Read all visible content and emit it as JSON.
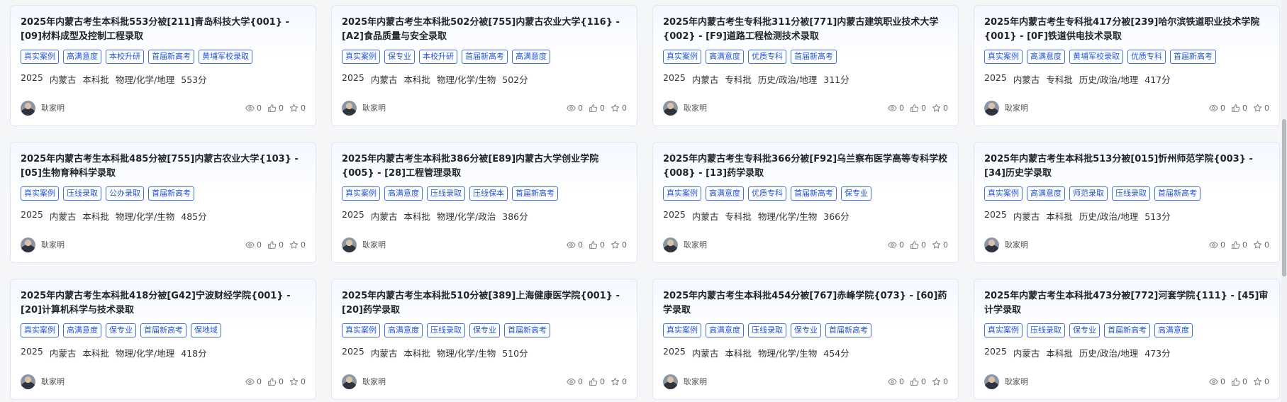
{
  "cards": [
    {
      "title": "2025年内蒙古考生本科批553分被[211]青岛科技大学{001} - [09]材料成型及控制工程录取",
      "tags": [
        "真实案例",
        "高满意度",
        "本校升研",
        "首届新高考",
        "黄埔军校录取"
      ],
      "meta": [
        "2025",
        "内蒙古",
        "本科批",
        "物理/化学/地理",
        "553分"
      ],
      "author": "耿家明",
      "views": "0",
      "likes": "0",
      "stars": "0"
    },
    {
      "title": "2025年内蒙古考生本科批502分被[755]内蒙古农业大学{116} - [A2]食品质量与安全录取",
      "tags": [
        "真实案例",
        "保专业",
        "本校升研",
        "首届新高考",
        "高满意度"
      ],
      "meta": [
        "2025",
        "内蒙古",
        "本科批",
        "物理/化学/生物",
        "502分"
      ],
      "author": "耿家明",
      "views": "0",
      "likes": "0",
      "stars": "0"
    },
    {
      "title": "2025年内蒙古考生专科批311分被[771]内蒙古建筑职业技术大学{002} - [F9]道路工程检测技术录取",
      "tags": [
        "真实案例",
        "高满意度",
        "优质专科",
        "首届新高考"
      ],
      "meta": [
        "2025",
        "内蒙古",
        "专科批",
        "历史/政治/地理",
        "311分"
      ],
      "author": "耿家明",
      "views": "0",
      "likes": "0",
      "stars": "0"
    },
    {
      "title": "2025年内蒙古考生专科批417分被[239]哈尔滨铁道职业技术学院{001} - [0F]铁道供电技术录取",
      "tags": [
        "真实案例",
        "高满意度",
        "黄埔军校录取",
        "优质专科",
        "首届新高考"
      ],
      "meta": [
        "2025",
        "内蒙古",
        "专科批",
        "历史/政治/地理",
        "417分"
      ],
      "author": "耿家明",
      "views": "0",
      "likes": "0",
      "stars": "0"
    },
    {
      "title": "2025年内蒙古考生本科批485分被[755]内蒙古农业大学{103} - [05]生物育种科学录取",
      "tags": [
        "真实案例",
        "压线录取",
        "公办录取",
        "首届新高考"
      ],
      "meta": [
        "2025",
        "内蒙古",
        "本科批",
        "物理/化学/生物",
        "485分"
      ],
      "author": "耿家明",
      "views": "0",
      "likes": "0",
      "stars": "0"
    },
    {
      "title": "2025年内蒙古考生本科批386分被[E89]内蒙古大学创业学院{005} - [28]工程管理录取",
      "tags": [
        "真实案例",
        "高满意度",
        "压线录取",
        "压线保本",
        "首届新高考"
      ],
      "meta": [
        "2025",
        "内蒙古",
        "本科批",
        "物理/化学/政治",
        "386分"
      ],
      "author": "耿家明",
      "views": "0",
      "likes": "0",
      "stars": "0"
    },
    {
      "title": "2025年内蒙古考生专科批366分被[F92]乌兰察布医学高等专科学校{008} - [13]药学录取",
      "tags": [
        "真实案例",
        "高满意度",
        "优质专科",
        "首届新高考",
        "保专业"
      ],
      "meta": [
        "2025",
        "内蒙古",
        "专科批",
        "物理/化学/生物",
        "366分"
      ],
      "author": "耿家明",
      "views": "0",
      "likes": "0",
      "stars": "0"
    },
    {
      "title": "2025年内蒙古考生本科批513分被[015]忻州师范学院{003} - [34]历史学录取",
      "tags": [
        "真实案例",
        "高满意度",
        "师范录取",
        "压线录取",
        "首届新高考"
      ],
      "meta": [
        "2025",
        "内蒙古",
        "本科批",
        "历史/政治/地理",
        "513分"
      ],
      "author": "耿家明",
      "views": "0",
      "likes": "0",
      "stars": "0"
    },
    {
      "title": "2025年内蒙古考生本科批418分被[G42]宁波财经学院{001} - [20]计算机科学与技术录取",
      "tags": [
        "真实案例",
        "高满意度",
        "保专业",
        "首届新高考",
        "保地域"
      ],
      "meta": [
        "2025",
        "内蒙古",
        "本科批",
        "物理/化学/地理",
        "418分"
      ],
      "author": "耿家明",
      "views": "0",
      "likes": "0",
      "stars": "0"
    },
    {
      "title": "2025年内蒙古考生本科批510分被[389]上海健康医学院{001} - [20]药学录取",
      "tags": [
        "真实案例",
        "高满意度",
        "压线录取",
        "保专业",
        "首届新高考"
      ],
      "meta": [
        "2025",
        "内蒙古",
        "本科批",
        "物理/化学/生物",
        "510分"
      ],
      "author": "耿家明",
      "views": "0",
      "likes": "0",
      "stars": "0"
    },
    {
      "title": "2025年内蒙古考生本科批454分被[767]赤峰学院{073} - [60]药学录取",
      "tags": [
        "真实案例",
        "高满意度",
        "压线录取",
        "保专业",
        "首届新高考"
      ],
      "meta": [
        "2025",
        "内蒙古",
        "本科批",
        "物理/化学/生物",
        "454分"
      ],
      "author": "耿家明",
      "views": "0",
      "likes": "0",
      "stars": "0"
    },
    {
      "title": "2025年内蒙古考生本科批473分被[772]河套学院{111} - [45]审计学录取",
      "tags": [
        "真实案例",
        "压线录取",
        "保专业",
        "首届新高考",
        "高满意度"
      ],
      "meta": [
        "2025",
        "内蒙古",
        "本科批",
        "历史/政治/地理",
        "473分"
      ],
      "author": "耿家明",
      "views": "0",
      "likes": "0",
      "stars": "0"
    }
  ],
  "icons": {
    "views": "eye-icon",
    "likes": "thumbs-up-icon",
    "stars": "star-icon"
  },
  "colors": {
    "tag_text": "#2456d6",
    "tag_border": "#3b6ff0",
    "card_bg_top": "#f3f7ff"
  }
}
